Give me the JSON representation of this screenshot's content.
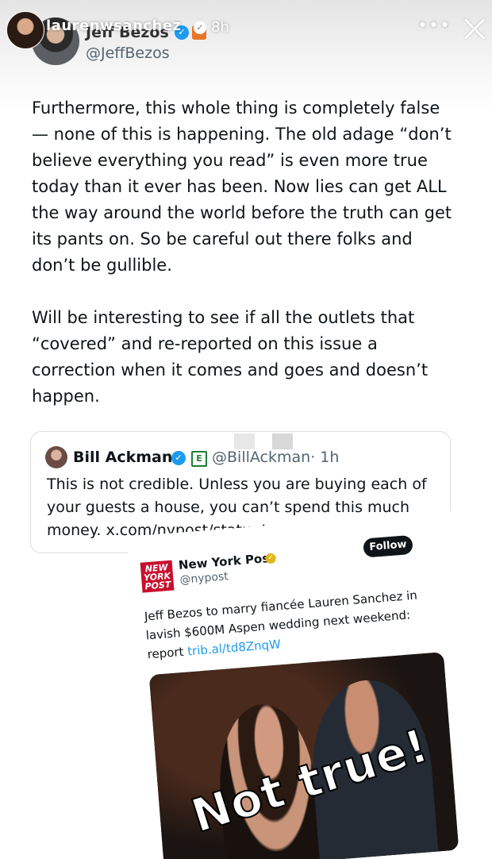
{
  "story": {
    "username": "laurenwsanchez",
    "time": "8h"
  },
  "tweet": {
    "author_name": "Jeff Bezos",
    "author_handle": "@JeffBezos",
    "paragraphs": [
      "Furthermore, this whole thing is completely false — none of this is happening. The old adage “don’t believe everything you read” is even more true today than it ever has been. Now lies can get ALL the way around the world before the truth can get its pants on. So be careful out there folks and don’t be gullible.",
      "Will be interesting to see if all the outlets that “covered” and re-reported on this issue a correction when it comes and goes and doesn’t happen."
    ]
  },
  "quoted": {
    "name": "Bill Ackman",
    "handle": "@BillAckman",
    "time": "· 1h",
    "text": "This is not credible. Unless you are buying each of your guests a house, you can’t spend this much money. x.com/nypost/status/..."
  },
  "nypost": {
    "logo_text": "NEW YORK POST",
    "name": "New York Post",
    "handle": "@nypost",
    "follow_label": "Follow",
    "text": "Jeff Bezos to marry fiancée Lauren Sanchez in lavish $600M Aspen wedding next weekend: report",
    "link": "trib.al/td8ZnqW",
    "overlay_text": "Not true!"
  },
  "icons": {
    "more": "more-icon",
    "close": "close-icon",
    "verified": "verified-badge-icon"
  },
  "colors": {
    "verified": "#1d9bf0",
    "nypost_red": "#c8102e",
    "text": "#0f1419",
    "muted": "#536471"
  }
}
